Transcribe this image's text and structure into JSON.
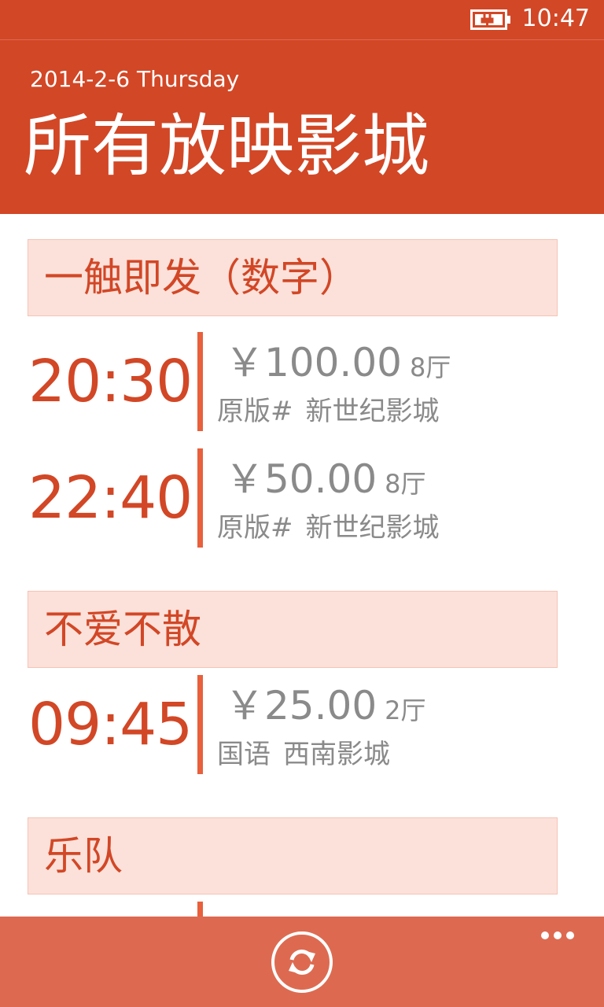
{
  "status_bar": {
    "time": "10:47",
    "battery_icon": "battery-charging-icon"
  },
  "header": {
    "date": "2014-2-6 Thursday",
    "title": "所有放映影城"
  },
  "movies": [
    {
      "title": "一触即发（数字）",
      "showtimes": [
        {
          "time": "20:30",
          "price": "￥100.00",
          "hall": "8厅",
          "version": "原版#",
          "cinema": "新世纪影城"
        },
        {
          "time": "22:40",
          "price": "￥50.00",
          "hall": "8厅",
          "version": "原版#",
          "cinema": "新世纪影城"
        }
      ]
    },
    {
      "title": "不爱不散",
      "showtimes": [
        {
          "time": "09:45",
          "price": "￥25.00",
          "hall": "2厅",
          "version": "国语",
          "cinema": "西南影城"
        }
      ]
    },
    {
      "title": "乐队",
      "showtimes": []
    }
  ],
  "app_bar": {
    "refresh_icon": "refresh-icon",
    "more_icon": "ellipsis-icon"
  },
  "colors": {
    "accent": "#d24726",
    "header_fill": "#fbe1da",
    "divider": "#e8603c",
    "app_bar": "#dd6a50",
    "secondary_text": "#8a8a8a"
  }
}
